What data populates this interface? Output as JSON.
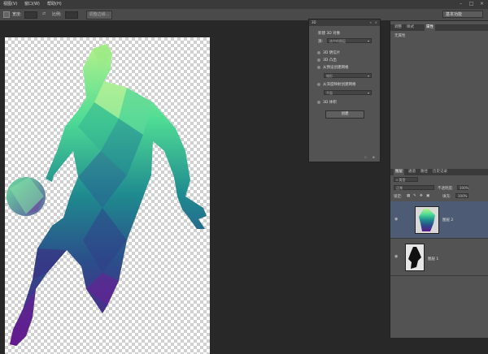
{
  "menu": {
    "items": [
      "视图(V)",
      "窗口(W)",
      "帮助(H)"
    ]
  },
  "options": {
    "label_feather": "宽度:",
    "label_ratio": "比例:",
    "button_refine": "调整边缘...",
    "workspace": "基本功能"
  },
  "panel3d": {
    "tab": "3D",
    "source_label": "新建 3D 对象",
    "source_prefix": "源:",
    "source_value": "选中的图层",
    "opt_postcard": "3D 明信片",
    "opt_extrusion": "3D 凸出",
    "opt_mesh_preset": "从预设创建网格",
    "mesh_preset_value": "锥形",
    "opt_depth_map": "从深度映射创建网格",
    "depth_map_value": "平面",
    "opt_volume": "3D 体积",
    "create_button": "创建"
  },
  "top_panel": {
    "tabs": [
      "调整",
      "样式",
      "属性"
    ],
    "content": "无属性"
  },
  "layers_panel": {
    "tabs": [
      "图层",
      "通道",
      "路径",
      "历史记录"
    ],
    "filter_kind": "类型",
    "blend_mode": "正常",
    "opacity_label": "不透明度:",
    "opacity_value": "100%",
    "lock_label": "锁定:",
    "fill_label": "填充:",
    "fill_value": "100%",
    "layers": [
      {
        "name": "图层 2"
      },
      {
        "name": "图层 1"
      }
    ]
  }
}
